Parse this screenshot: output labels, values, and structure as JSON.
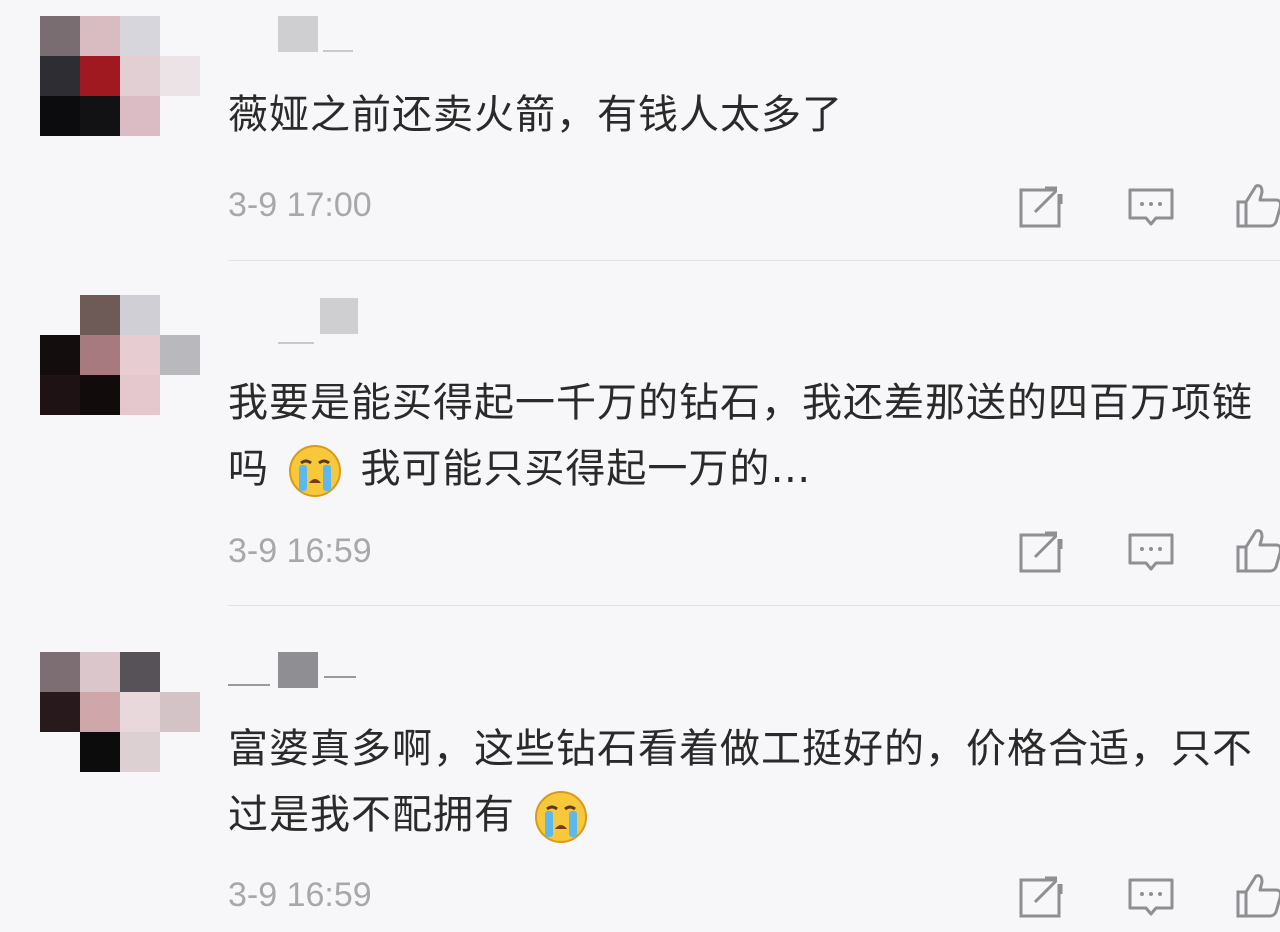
{
  "comments": [
    {
      "text": "薇娅之前还卖火箭，有钱人太多了",
      "time": "3-9 17:00"
    },
    {
      "text_part1": "我要是能买得起一千万的钻石，我还差那送的四百万项链吗",
      "text_part2": "我可能只买得起一万的…",
      "time": "3-9 16:59"
    },
    {
      "text_part1": "富婆真多啊，这些钻石看着做工挺好的，价格合适，只不过是我不配拥有",
      "time": "3-9 16:59"
    }
  ],
  "icons": {
    "share": "share-icon",
    "reply": "comment-icon",
    "like": "thumbs-up-icon",
    "emoji": "crying-emoji-icon"
  },
  "colors": {
    "background": "#f7f7f9",
    "text": "#2a2a2a",
    "meta": "#a8a8ab",
    "icon": "#8e8e93"
  }
}
